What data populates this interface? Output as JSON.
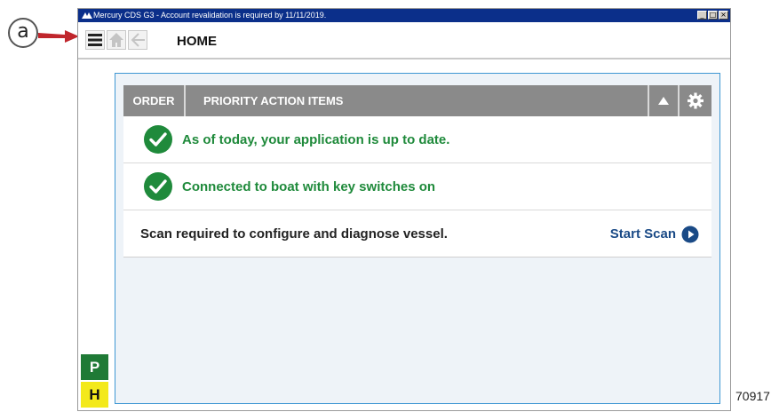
{
  "callout": {
    "label": "a"
  },
  "window": {
    "title": "Mercury CDS G3 - Account revalidation is required by 11/11/2019.",
    "controls": {
      "minimize": "_",
      "maximize": "□",
      "close": "×"
    }
  },
  "toolbar": {
    "page_title": "HOME",
    "menu_icon": "hamburger-icon",
    "home_icon": "home-icon",
    "back_icon": "back-arrow-icon"
  },
  "panel": {
    "order_label": "ORDER",
    "title": "PRIORITY ACTION ITEMS",
    "rows": [
      {
        "text": "As of today, your application is up to date.",
        "status": "ok"
      },
      {
        "text": "Connected to boat with key switches on",
        "status": "ok"
      },
      {
        "text": "Scan required to configure and diagnose vessel.",
        "action": "Start Scan"
      }
    ]
  },
  "side_tabs": {
    "p": "P",
    "h": "H"
  },
  "figure_id": "70917",
  "colors": {
    "titlebar": "#0b2f8a",
    "panel_header": "#8a8a8a",
    "ok_green": "#1f8a3b",
    "link_blue": "#1a4a86",
    "frame_border": "#3f97d3",
    "p_tab": "#1f7a36",
    "h_tab": "#f3e91b"
  }
}
